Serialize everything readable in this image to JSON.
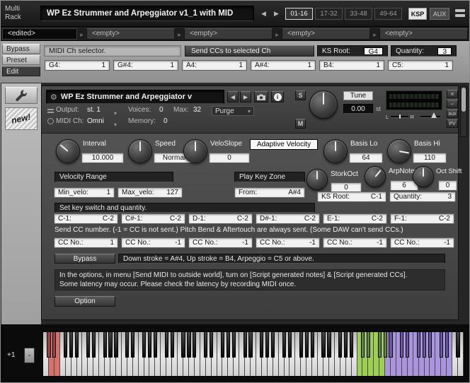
{
  "multi_header": {
    "app_name_line1": "Multi",
    "app_name_line2": "Rack",
    "title": "WP Ez Strummer and Arpeggiator v1_1 with MID",
    "pages": [
      {
        "label": "01-16"
      },
      {
        "label": "17-32"
      },
      {
        "label": "33-48"
      },
      {
        "label": "49-64"
      }
    ],
    "active_page": "01-16",
    "ksp_label": "KSP",
    "aux_label": "AUX"
  },
  "tab_strip": {
    "tabs": [
      {
        "label": "<edited>"
      },
      {
        "label": "<empty>"
      },
      {
        "label": "<empty>"
      },
      {
        "label": "<empty>"
      },
      {
        "label": "<empty>"
      }
    ],
    "active_tab": "<edited>"
  },
  "multi_panel": {
    "bypass_label": "Bypass",
    "preset_label": "Preset",
    "edit_label": "Edit",
    "midi_ch_selector_label": "MIDI Ch selector.",
    "send_ccs_label": "Send CCs to selected Ch",
    "ks_root_label": "KS Root:",
    "ks_root_value": "G4",
    "quantity_label": "Quantity:",
    "quantity_value": "3",
    "note_quantities": [
      {
        "label": "G4:",
        "value": "1"
      },
      {
        "label": "G#4:",
        "value": "1"
      },
      {
        "label": "A4:",
        "value": "1"
      },
      {
        "label": "A#4:",
        "value": "1"
      },
      {
        "label": "B4:",
        "value": "1"
      },
      {
        "label": "C5:",
        "value": "1"
      }
    ]
  },
  "instrument": {
    "sidebar": {
      "new_badge_label": "new!"
    },
    "header": {
      "title": "WP Ez Strummer and Arpeggiator v",
      "output_label": "Output:",
      "output_value": "st. 1",
      "voices_label": "Voices:",
      "voices_value": "0",
      "max_label": "Max:",
      "max_value": "32",
      "purge_label": "Purge",
      "midi_ch_label": "MIDI Ch:",
      "midi_ch_value": "Omni",
      "memory_label": "Memory:",
      "memory_value": "0",
      "solo_label": "S",
      "mute_label": "M",
      "tune": {
        "label": "Tune",
        "value": "0.00",
        "unit": "st",
        "angle": 0
      },
      "pan_left_label": "L",
      "pan_right_label": "R",
      "close_label": "×",
      "minimize_label": "−",
      "aux_label": "aux",
      "pv_label": "PV"
    },
    "performance": {
      "knobs": {
        "interval": {
          "label": "Interval",
          "value": "10.000",
          "angle": -50
        },
        "speed": {
          "label": "Speed",
          "value": "Normal",
          "angle": 0
        },
        "veloslope": {
          "label": "VeloSlope",
          "value": "0",
          "angle": 0
        },
        "basis_lo": {
          "label": "Basis Lo",
          "value": "64",
          "angle": 0
        },
        "basis_hi": {
          "label": "Basis Hi",
          "value": "110",
          "angle": 100
        },
        "storkoct": {
          "label": "StorkOct",
          "value": "0",
          "angle": 0
        },
        "arpnotes": {
          "label": "ArpNotes",
          "value": "6",
          "angle": 40
        },
        "oct_shift": {
          "label": "Oct Shift",
          "value": "0",
          "angle": 0
        }
      },
      "adaptive_velocity_label": "Adaptive Velocity",
      "velocity_range_label": "Velocity Range",
      "play_key_zone_label": "Play Key Zone",
      "min_velo": {
        "label": "Min_velo:",
        "value": "1"
      },
      "max_velo": {
        "label": "Max_velo:",
        "value": "127"
      },
      "from_key": {
        "label": "From:",
        "value": "A#4"
      },
      "ks_root": {
        "label": "KS Root:",
        "value": "C-1"
      },
      "quantity": {
        "label": "Quantity:",
        "value": "3"
      },
      "set_ks_label": "Set key switch and quantity.",
      "key_switches": [
        {
          "label": "C-1:",
          "value": "C-2"
        },
        {
          "label": "C#-1:",
          "value": "C-2"
        },
        {
          "label": "D-1:",
          "value": "C-2"
        },
        {
          "label": "D#-1:",
          "value": "C-2"
        },
        {
          "label": "E-1:",
          "value": "C-2"
        },
        {
          "label": "F-1:",
          "value": "C-2"
        }
      ],
      "cc_note": "Send CC number.  (-1 = CC is not sent.)  Pitch Bend & Aftertouch are always sent.   (Some DAW can't send CCs.)",
      "cc_numbers": [
        {
          "label": "CC No.:",
          "value": "1"
        },
        {
          "label": "CC No.:",
          "value": "-1"
        },
        {
          "label": "CC No.:",
          "value": "-1"
        },
        {
          "label": "CC No.:",
          "value": "-1"
        },
        {
          "label": "CC No.:",
          "value": "-1"
        },
        {
          "label": "CC No.:",
          "value": "-1"
        }
      ],
      "bypass_label": "Bypass",
      "stroke_info": "Down stroke = A#4, Up stroke = B4, Arpeggio = C5 or above.",
      "options_info_line1": "In the options, in menu [Send MIDI to outside world], turn on [Script generated notes] & [Script generated CCs].",
      "options_info_line2": "Some latency may occur. Please check the latency by recording MIDI once.",
      "option_button_label": "Option"
    }
  },
  "keyboard": {
    "octave_up_label": "+1",
    "octave_down_label": "-",
    "white_key_count": 75,
    "colored_ranges": [
      {
        "name": "keyswitch-keys",
        "from": 1,
        "to": 2,
        "white": "#d9716b",
        "black": "#9c423e"
      },
      {
        "name": "strum-keys",
        "from": 56,
        "to": 60,
        "white": "#9ccf52",
        "black": "#5f8a30"
      },
      {
        "name": "arpeggio-keys",
        "from": 61,
        "to": 72,
        "white": "#a994dd",
        "black": "#6a57a0"
      }
    ]
  }
}
